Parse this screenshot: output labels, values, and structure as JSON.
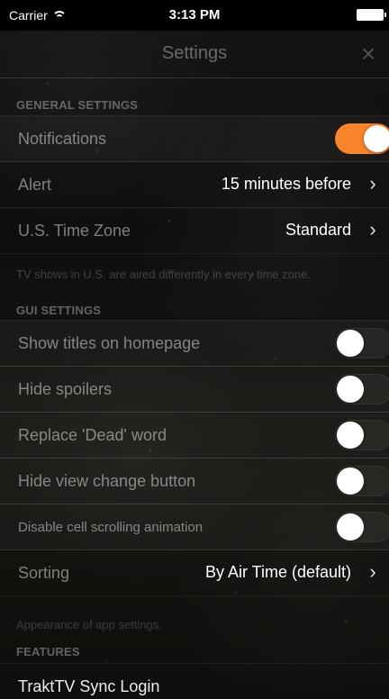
{
  "status_bar": {
    "carrier": "Carrier",
    "wifi_icon": "wifi-icon",
    "time": "3:13 PM",
    "battery_icon": "battery-icon"
  },
  "nav": {
    "title": "Settings",
    "close_icon": "close-icon",
    "close_glyph": "×"
  },
  "general_settings": {
    "header": "GENERAL SETTINGS",
    "notifications": {
      "label": "Notifications",
      "toggle": true,
      "toggle_color": "#f7842b"
    },
    "alert": {
      "label": "Alert",
      "value": "15 minutes before"
    },
    "time_zone": {
      "label": "U.S. Time Zone",
      "value": "Standard"
    },
    "footer": "TV shows in U.S. are aired differently in every time zone."
  },
  "gui_settings": {
    "header": "GUI SETTINGS",
    "items": [
      {
        "label": "Show titles on homepage",
        "toggle": false
      },
      {
        "label": "Hide spoilers",
        "toggle": false
      },
      {
        "label": "Replace 'Dead' word",
        "toggle": false
      },
      {
        "label": "Hide view change button",
        "toggle": false
      },
      {
        "label": "Disable cell scrolling animation",
        "toggle": false
      }
    ],
    "sorting": {
      "label": "Sorting",
      "value": "By Air Time (default)"
    },
    "footer": "Appearance of app settings."
  },
  "features": {
    "header": "FEATURES",
    "items": [
      {
        "label": "TraktTV Sync Login"
      }
    ]
  },
  "colors": {
    "accent": "#f7842b",
    "background": "#0e0d0b"
  }
}
